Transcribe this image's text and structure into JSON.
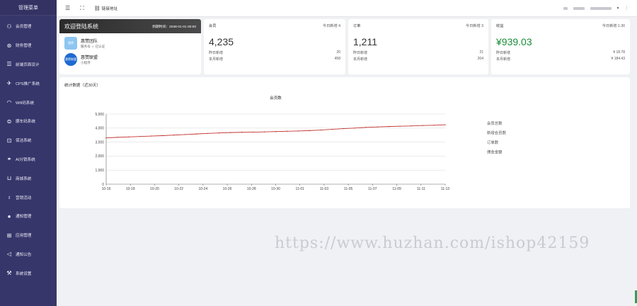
{
  "sidebar": {
    "title": "管理菜单",
    "items": [
      {
        "label": "会员管理",
        "icon": "user-icon"
      },
      {
        "label": "财务管理",
        "icon": "finance-icon"
      },
      {
        "label": "前端页面设计",
        "icon": "layout-icon"
      },
      {
        "label": "CPS推广系统",
        "icon": "send-icon"
      },
      {
        "label": "Wifi码系统",
        "icon": "wifi-icon"
      },
      {
        "label": "挪车码系统",
        "icon": "car-icon"
      },
      {
        "label": "保洁系统",
        "icon": "broom-icon"
      },
      {
        "label": "AI分销系统",
        "icon": "ai-icon"
      },
      {
        "label": "商城系统",
        "icon": "cart-icon"
      },
      {
        "label": "营销活动",
        "icon": "gift-icon"
      },
      {
        "label": "通知管理",
        "icon": "circle-icon"
      },
      {
        "label": "应用管理",
        "icon": "apps-icon"
      },
      {
        "label": "通知公告",
        "icon": "speaker-icon"
      },
      {
        "label": "系统设置",
        "icon": "tools-icon"
      }
    ]
  },
  "topbar": {
    "link_label": "链接地址"
  },
  "welcome": {
    "title": "欢迎登陆系统",
    "expire": "到期时间：2038-01-01 00:00",
    "orgs": [
      {
        "name": "惠赞团队",
        "sub": "服务号 ☆ 已认证",
        "logo": "惠赞"
      },
      {
        "name": "惠赞联盟",
        "sub": "小程序",
        "logo": "惠赞联盟"
      }
    ]
  },
  "stats": [
    {
      "label": "会员",
      "today": "今日新增 4",
      "value": "4,235",
      "rows": [
        [
          "昨日新增",
          "20"
        ],
        [
          "本月新增",
          "458"
        ]
      ]
    },
    {
      "label": "订单",
      "today": "今日新增 3",
      "value": "1,211",
      "rows": [
        [
          "昨日新增",
          "21"
        ],
        [
          "本月新增",
          "204"
        ]
      ]
    },
    {
      "label": "收益",
      "today": "今日新增 1.30",
      "value": "¥939.03",
      "rows": [
        [
          "昨日新增",
          "¥ 18.78"
        ],
        [
          "本月新增",
          "¥ 184.43"
        ]
      ]
    }
  ],
  "panel": {
    "title": "统计数据（近30天）"
  },
  "chart_data": {
    "type": "line",
    "title": "会员数",
    "ylim": [
      0,
      5000
    ],
    "yticks": [
      "0",
      "1,000",
      "2,000",
      "3,000",
      "4,000",
      "5,000"
    ],
    "xticks": [
      "10-16",
      "10-18",
      "10-20",
      "10-22",
      "10-24",
      "10-26",
      "10-28",
      "10-30",
      "11-01",
      "11-03",
      "11-05",
      "11-07",
      "11-09",
      "11-11",
      "11-13"
    ],
    "series": [
      {
        "name": "会员总数",
        "color": "#c23531",
        "values": [
          3300,
          3340,
          3370,
          3400,
          3430,
          3460,
          3500,
          3540,
          3580,
          3620,
          3650,
          3680,
          3700,
          3710,
          3730,
          3750,
          3770,
          3790,
          3820,
          3860,
          3910,
          3960,
          4000,
          4050,
          4080,
          4110,
          4130,
          4150,
          4180,
          4200,
          4235
        ]
      },
      {
        "name": "新增会员数",
        "color": "#999999",
        "values": []
      },
      {
        "name": "订单数",
        "color": "#999999",
        "values": []
      },
      {
        "name": "佣金金额",
        "color": "#999999",
        "values": []
      }
    ]
  },
  "watermark": "https://www.huzhan.com/ishop42159"
}
